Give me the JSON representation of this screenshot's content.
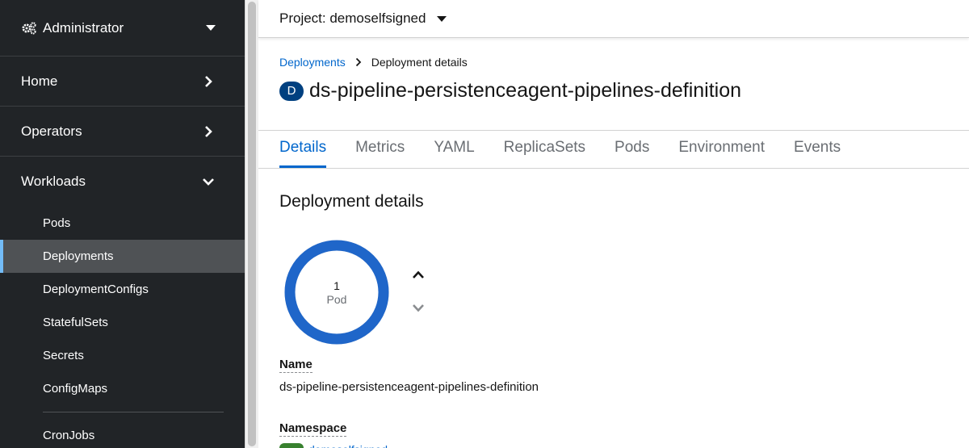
{
  "sidebar": {
    "perspective": {
      "label": "Administrator",
      "icon": "gears-icon"
    },
    "sections": [
      {
        "label": "Home",
        "state": "collapsed"
      },
      {
        "label": "Operators",
        "state": "collapsed"
      },
      {
        "label": "Workloads",
        "state": "expanded"
      }
    ],
    "workloads_items": [
      {
        "label": "Pods"
      },
      {
        "label": "Deployments",
        "active": true
      },
      {
        "label": "DeploymentConfigs"
      },
      {
        "label": "StatefulSets"
      },
      {
        "label": "Secrets"
      },
      {
        "label": "ConfigMaps"
      },
      {
        "label": "CronJobs"
      }
    ]
  },
  "project": {
    "label": "Project: demoselfsigned"
  },
  "breadcrumb": {
    "parent": "Deployments",
    "current": "Deployment details"
  },
  "resource": {
    "badge": "D",
    "title": "ds-pipeline-persistenceagent-pipelines-definition"
  },
  "tabs": [
    "Details",
    "Metrics",
    "YAML",
    "ReplicaSets",
    "Pods",
    "Environment",
    "Events"
  ],
  "active_tab": "Details",
  "details": {
    "section_title": "Deployment details",
    "pod_count": "1",
    "pod_unit": "Pod",
    "pod_ring_fraction": 1.0,
    "name_label": "Name",
    "name_value": "ds-pipeline-persistenceagent-pipelines-definition",
    "namespace_label": "Namespace",
    "namespace_badge": "NS",
    "namespace_value": "demoselfsigned"
  },
  "colors": {
    "sidebar_bg": "#212427",
    "active_accent": "#73bcf7",
    "link": "#0066cc",
    "badge_bg": "#004080",
    "donut": "#1f66c9",
    "ns_badge": "#38812f"
  }
}
